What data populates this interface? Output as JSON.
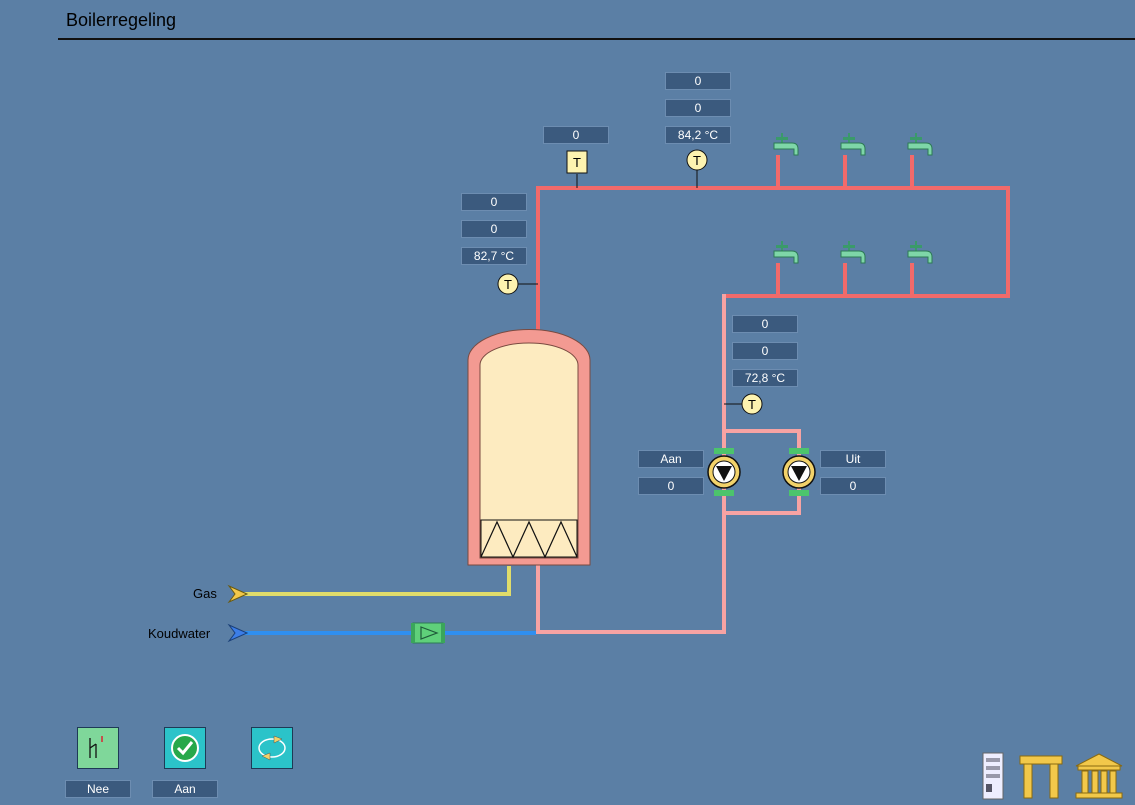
{
  "title": "Boilerregeling",
  "sensors": {
    "top_left": {
      "v1": "0",
      "v2": "0",
      "temp": "82,7 °C",
      "symbol": "T"
    },
    "top_mid": {
      "v1": "0",
      "symbol": "T"
    },
    "top_right": {
      "v1": "0",
      "v2": "0",
      "temp": "84,2 °C",
      "symbol": "T"
    },
    "return": {
      "v1": "0",
      "v2": "0",
      "temp": "72,8 °C",
      "symbol": "T"
    }
  },
  "pumps": {
    "left": {
      "status": "Aan",
      "value": "0"
    },
    "right": {
      "status": "Uit",
      "value": "0"
    }
  },
  "inputs": {
    "gas": "Gas",
    "cold_water": "Koudwater"
  },
  "controls": {
    "switch_label": "Nee",
    "enable_label": "Aan"
  },
  "colors": {
    "background": "#5b7fa5",
    "hot_pipe": "#f26a6a",
    "return_pipe": "#f7a3a3",
    "gas_pipe": "#e0dc6a",
    "water_pipe": "#2f8ff0",
    "tank_fill": "#fdebc0",
    "tank_shell": "#f39a92"
  },
  "icons": [
    "tap-icon",
    "temperature-sensor-icon",
    "pump-icon",
    "valve-icon",
    "switch-icon",
    "check-icon",
    "refresh-icon",
    "server-icon",
    "gate-icon",
    "building-icon"
  ]
}
